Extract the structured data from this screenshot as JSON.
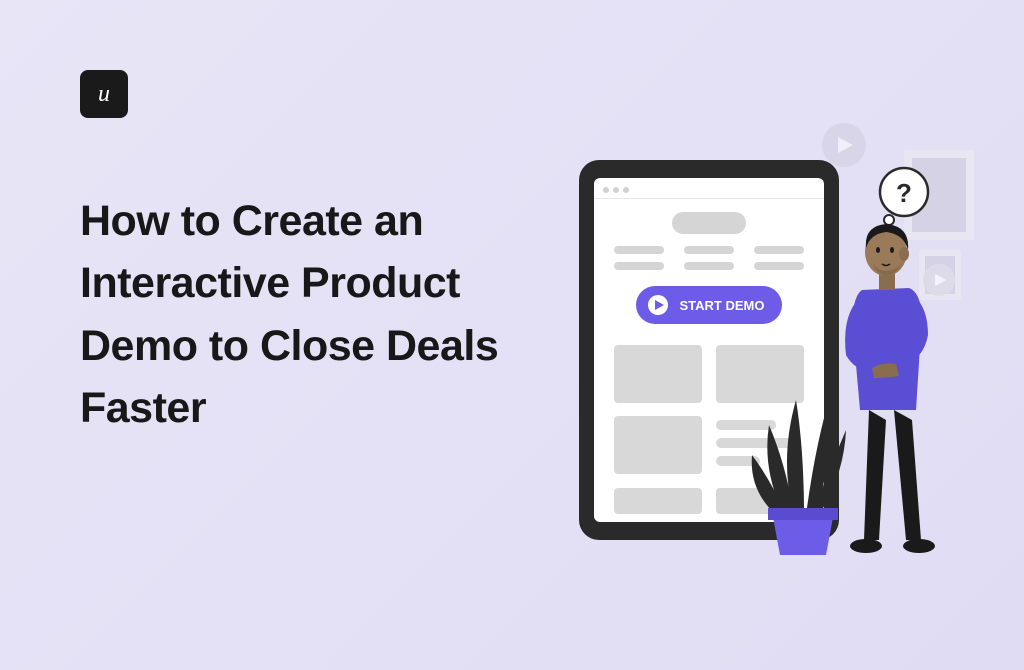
{
  "logo_letter": "u",
  "heading": "How to Create an Interactive Product Demo to Close Deals Faster",
  "illustration": {
    "button_label": "START DEMO",
    "thought_bubble": "?"
  }
}
